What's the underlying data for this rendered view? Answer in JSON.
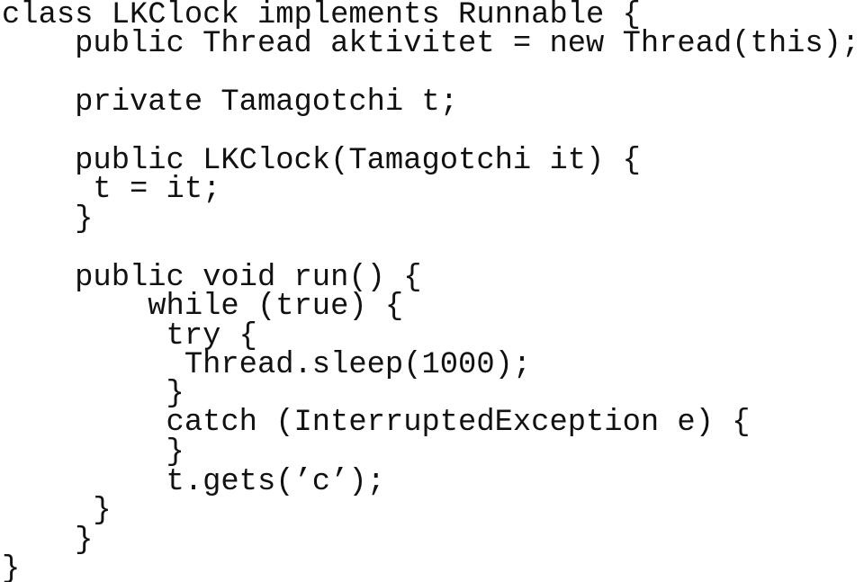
{
  "document": {
    "language": "Java",
    "lines": [
      {
        "indent": 0,
        "text": "class LKClock implements Runnable {"
      },
      {
        "indent": 4,
        "text": "public Thread aktivitet = new Thread(this);"
      },
      {
        "indent": 0,
        "text": ""
      },
      {
        "indent": 4,
        "text": "private Tamagotchi t;"
      },
      {
        "indent": 0,
        "text": ""
      },
      {
        "indent": 4,
        "text": "public LKClock(Tamagotchi it) {"
      },
      {
        "indent": 5,
        "text": "t = it;"
      },
      {
        "indent": 4,
        "text": "}"
      },
      {
        "indent": 0,
        "text": ""
      },
      {
        "indent": 4,
        "text": "public void run() {"
      },
      {
        "indent": 8,
        "text": "while (true) {"
      },
      {
        "indent": 9,
        "text": "try {"
      },
      {
        "indent": 10,
        "text": "Thread.sleep(1000);"
      },
      {
        "indent": 9,
        "text": "}"
      },
      {
        "indent": 9,
        "text": "catch (InterruptedException e) {"
      },
      {
        "indent": 9,
        "text": "}"
      },
      {
        "indent": 9,
        "text": "t.gets(’c’);"
      },
      {
        "indent": 5,
        "text": "}"
      },
      {
        "indent": 4,
        "text": "}"
      },
      {
        "indent": 0,
        "text": "}"
      }
    ]
  }
}
